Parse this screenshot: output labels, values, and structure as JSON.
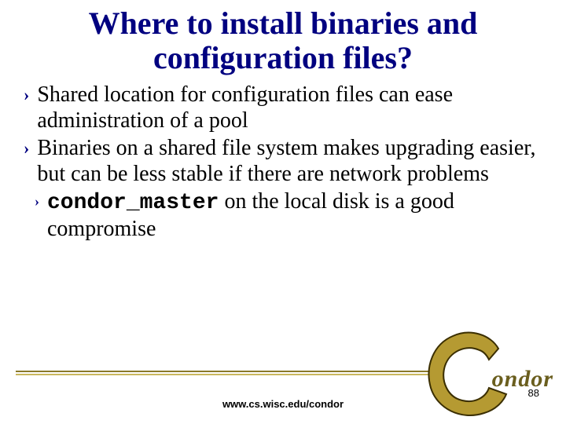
{
  "title": "Where to install binaries and configuration files?",
  "bullets": [
    "Shared location for configuration files can ease administration of a pool",
    "Binaries on a shared file system makes upgrading easier, but can be less stable if there are network problems"
  ],
  "sub_bullet": {
    "code": "condor_master",
    "rest": " on the local disk is a good compromise"
  },
  "footer_url": "www.cs.wisc.edu/condor",
  "page_number": "88",
  "logo_text": "ondor"
}
